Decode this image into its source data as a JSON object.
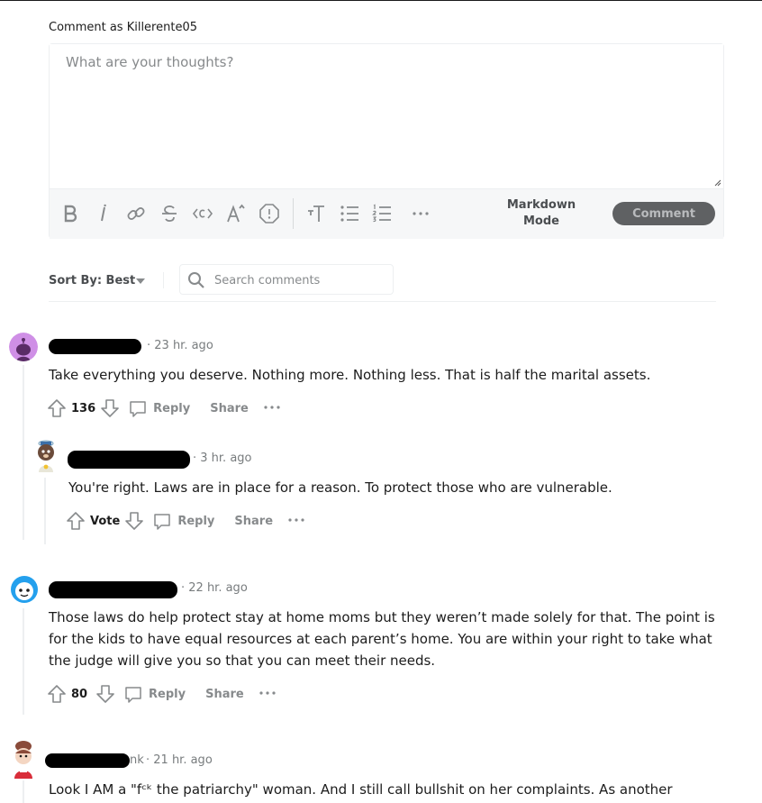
{
  "composer": {
    "comment_as": "Comment as Killerente05",
    "placeholder": "What are your thoughts?",
    "toolbar_icons": [
      "bold-icon",
      "italic-icon",
      "link-icon",
      "strikethrough-icon",
      "inline-code-icon",
      "superscript-icon",
      "spoiler-icon",
      "heading-icon",
      "bulleted-list-icon",
      "numbered-list-icon",
      "more-icon"
    ],
    "markdown_line1": "Markdown",
    "markdown_line2": "Mode",
    "submit_label": "Comment"
  },
  "sort": {
    "label": "Sort By: Best",
    "search_placeholder": "Search comments"
  },
  "comments": [
    {
      "time": "· 23 hr. ago",
      "body": "Take everything you deserve. Nothing more. Nothing less. That is half the marital assets.",
      "score": "136",
      "reply": "Reply",
      "share": "Share",
      "avatar_color": "#cf8fe6"
    },
    {
      "time": "· 3 hr. ago",
      "body": "You're right. Laws are in place for a reason. To protect those who are vulnerable.",
      "score": "Vote",
      "reply": "Reply",
      "share": "Share"
    },
    {
      "time": "· 22 hr. ago",
      "body": "Those laws do help protect stay at home moms but they weren’t made solely for that. The point is for the kids to have equal resources at each parent’s home. You are within your right to take what the judge will give you so that you can meet their needs.",
      "score": "80",
      "reply": "Reply",
      "share": "Share",
      "avatar_color": "#24a0ed"
    },
    {
      "time": "· 21 hr. ago",
      "body": "Look I AM a \"fᶜᵏ the patriarchy\" woman. And I still call bullshit on her complaints. As another",
      "redacted_name_tail": "nk"
    }
  ]
}
